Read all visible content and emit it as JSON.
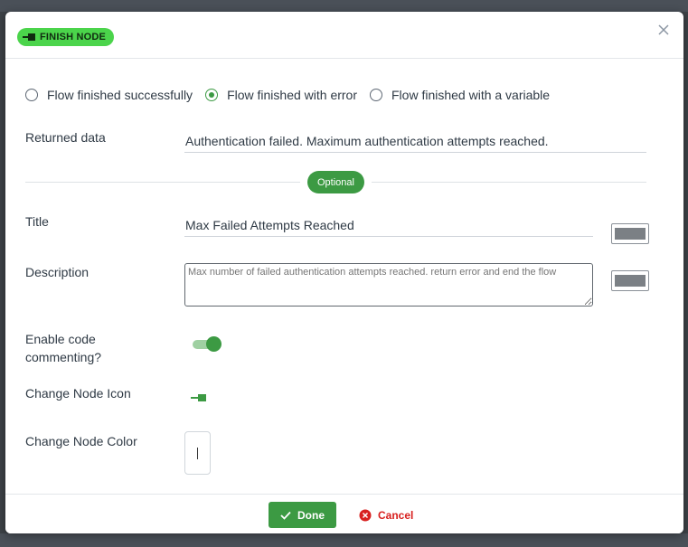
{
  "modal": {
    "badge_label": "FINISH NODE",
    "close_icon": "close-icon"
  },
  "finish_type": {
    "options": [
      {
        "label": "Flow finished successfully",
        "selected": false
      },
      {
        "label": "Flow finished with error",
        "selected": true
      },
      {
        "label": "Flow finished with a variable",
        "selected": false
      }
    ]
  },
  "returned_data": {
    "label": "Returned data",
    "value": "Authentication failed. Maximum authentication attempts reached."
  },
  "optional_label": "Optional",
  "title_field": {
    "label": "Title",
    "value": "Max Failed Attempts Reached"
  },
  "description_field": {
    "label": "Description",
    "placeholder": "Max number of failed authentication attempts reached. return error and end the flow"
  },
  "code_commenting": {
    "label": "Enable code commenting?",
    "enabled": true
  },
  "node_icon": {
    "label": "Change Node Icon",
    "icon": "finish-node-icon"
  },
  "node_color": {
    "label": "Change Node Color"
  },
  "footer": {
    "done_label": "Done",
    "cancel_label": "Cancel"
  },
  "colors": {
    "badge": "#4bd44b",
    "accent_green": "#3c9a43",
    "cancel_red": "#d8201f"
  }
}
